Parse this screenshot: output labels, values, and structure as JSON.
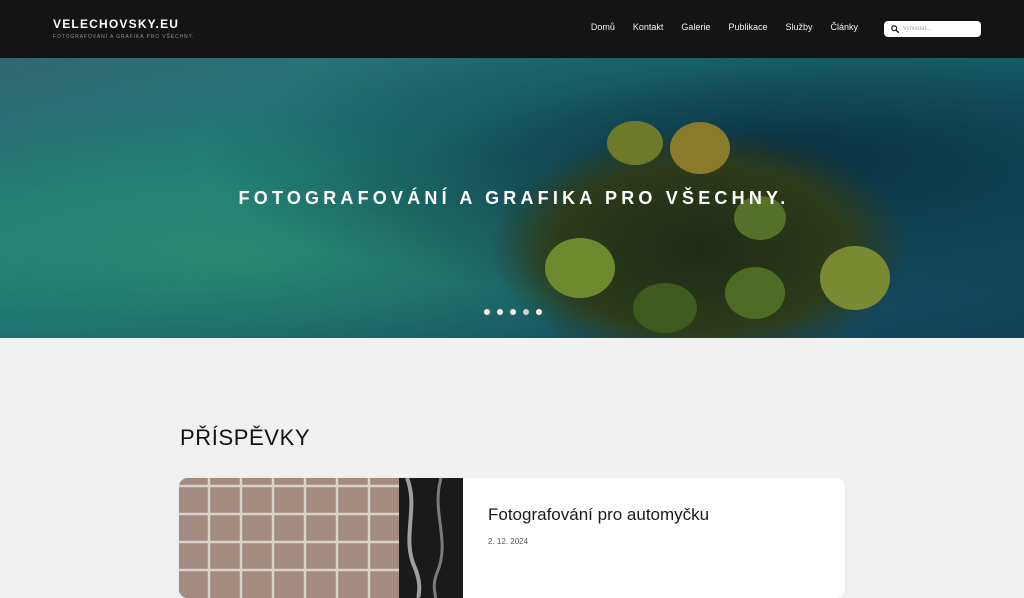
{
  "brand": {
    "title": "VELECHOVSKY.EU",
    "tagline": "FOTOGRAFOVÁNÍ A GRAFIKA PRO VŠECHNY."
  },
  "nav": {
    "items": [
      "Domů",
      "Kontakt",
      "Galerie",
      "Publikace",
      "Služby",
      "Články"
    ]
  },
  "search": {
    "placeholder": "Vyhledat...",
    "icon": "search-icon"
  },
  "hero": {
    "caption": "FOTOGRAFOVÁNÍ A GRAFIKA PRO VŠECHNY.",
    "slide_count": 5,
    "active_slide": 4
  },
  "posts": {
    "heading": "PŘÍSPĚVKY",
    "items": [
      {
        "title": "Fotografování pro automyčku",
        "date": "2. 12. 2024"
      }
    ]
  },
  "colors": {
    "header_bg": "#141414",
    "page_bg": "#f1f1f1",
    "card_bg": "#ffffff"
  }
}
